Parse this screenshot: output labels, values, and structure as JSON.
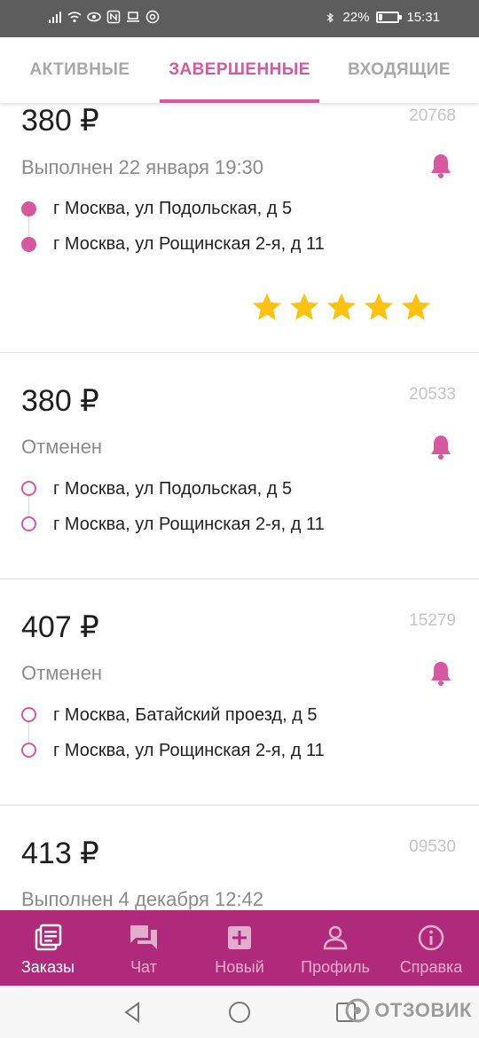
{
  "status_bar": {
    "battery": "22%",
    "battery_level": 0.22,
    "time": "15:31",
    "icons": [
      "signal-icon",
      "wifi-icon",
      "eye-icon",
      "nfc-icon",
      "laptop-icon",
      "at-icon",
      "bluetooth-icon",
      "battery-icon"
    ]
  },
  "tabs": [
    {
      "label": "АКТИВНЫЕ",
      "active": false
    },
    {
      "label": "ЗАВЕРШЕННЫЕ",
      "active": true
    },
    {
      "label": "ВХОДЯЩИЕ",
      "active": false
    }
  ],
  "orders": [
    {
      "price": "380 ₽",
      "id": "20768",
      "status": "Выполнен 22 января 19:30",
      "from": "г Москва, ул Подольская, д 5",
      "to": "г Москва, ул Рощинская 2-я, д 11",
      "points_filled": true,
      "rating": 5
    },
    {
      "price": "380 ₽",
      "id": "20533",
      "status": "Отменен",
      "from": "г Москва, ул Подольская, д 5",
      "to": "г Москва, ул Рощинская 2-я, д 11",
      "points_filled": false
    },
    {
      "price": "407 ₽",
      "id": "15279",
      "status": "Отменен",
      "from": "г Москва, Батайский проезд, д 5",
      "to": "г Москва, ул Рощинская 2-я, д 11",
      "points_filled": false
    },
    {
      "price": "413 ₽",
      "id": "09530",
      "status": "Выполнен 4 декабря 12:42"
    }
  ],
  "bottom_nav": [
    {
      "label": "Заказы",
      "icon": "orders-icon",
      "active": true
    },
    {
      "label": "Чат",
      "icon": "chat-icon",
      "active": false
    },
    {
      "label": "Новый",
      "icon": "plus-box-icon",
      "active": false
    },
    {
      "label": "Профиль",
      "icon": "profile-icon",
      "active": false
    },
    {
      "label": "Справка",
      "icon": "info-icon",
      "active": false
    }
  ],
  "watermark": "ОТЗОВИК",
  "colors": {
    "accent": "#d6589f",
    "nav_bg": "#b02a7c",
    "star": "#ffc20e",
    "status_bar": "#5d5d5d"
  }
}
